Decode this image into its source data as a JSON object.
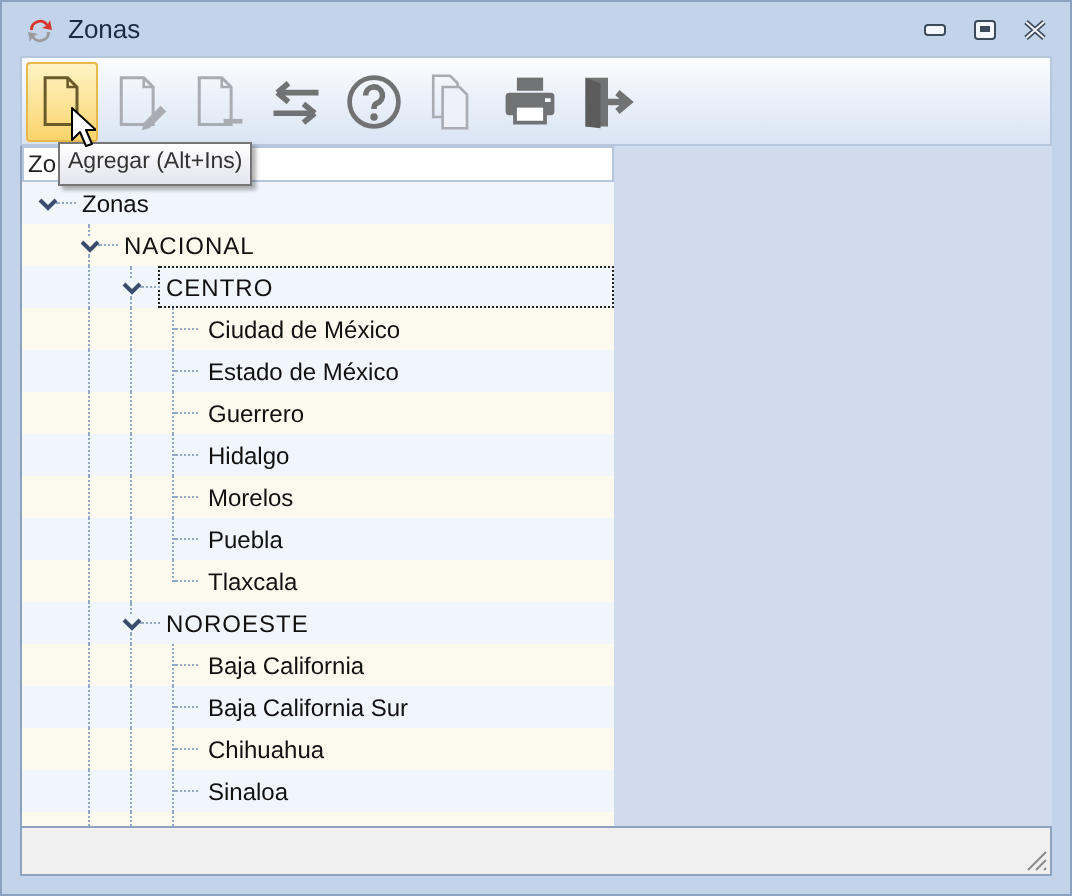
{
  "window": {
    "title": "Zonas"
  },
  "toolbar": [
    {
      "kind": "new",
      "highlighted": true,
      "disabled": false
    },
    {
      "kind": "edit",
      "highlighted": false,
      "disabled": true
    },
    {
      "kind": "delete",
      "highlighted": false,
      "disabled": true
    },
    {
      "kind": "swap",
      "highlighted": false,
      "disabled": false
    },
    {
      "kind": "help",
      "highlighted": false,
      "disabled": false
    },
    {
      "kind": "copy",
      "highlighted": false,
      "disabled": true
    },
    {
      "kind": "print",
      "highlighted": false,
      "disabled": false
    },
    {
      "kind": "exit",
      "highlighted": false,
      "disabled": false
    }
  ],
  "tooltip": "Agregar (Alt+Ins)",
  "tree": {
    "header": "Zo",
    "nodes": [
      {
        "label": "Zonas",
        "expanded": true,
        "selected": false,
        "children": [
          {
            "label": "NACIONAL",
            "expanded": true,
            "selected": false,
            "children": [
              {
                "label": "CENTRO",
                "expanded": true,
                "selected": true,
                "children": [
                  {
                    "label": "Ciudad de México",
                    "selected": false
                  },
                  {
                    "label": "Estado de México",
                    "selected": false
                  },
                  {
                    "label": "Guerrero",
                    "selected": false
                  },
                  {
                    "label": "Hidalgo",
                    "selected": false
                  },
                  {
                    "label": "Morelos",
                    "selected": false
                  },
                  {
                    "label": "Puebla",
                    "selected": false
                  },
                  {
                    "label": "Tlaxcala",
                    "selected": false
                  }
                ]
              },
              {
                "label": "NOROESTE",
                "expanded": true,
                "selected": false,
                "children": [
                  {
                    "label": "Baja California",
                    "selected": false
                  },
                  {
                    "label": "Baja California Sur",
                    "selected": false
                  },
                  {
                    "label": "Chihuahua",
                    "selected": false
                  },
                  {
                    "label": "Sinaloa",
                    "selected": false
                  }
                ]
              }
            ]
          }
        ]
      }
    ]
  }
}
